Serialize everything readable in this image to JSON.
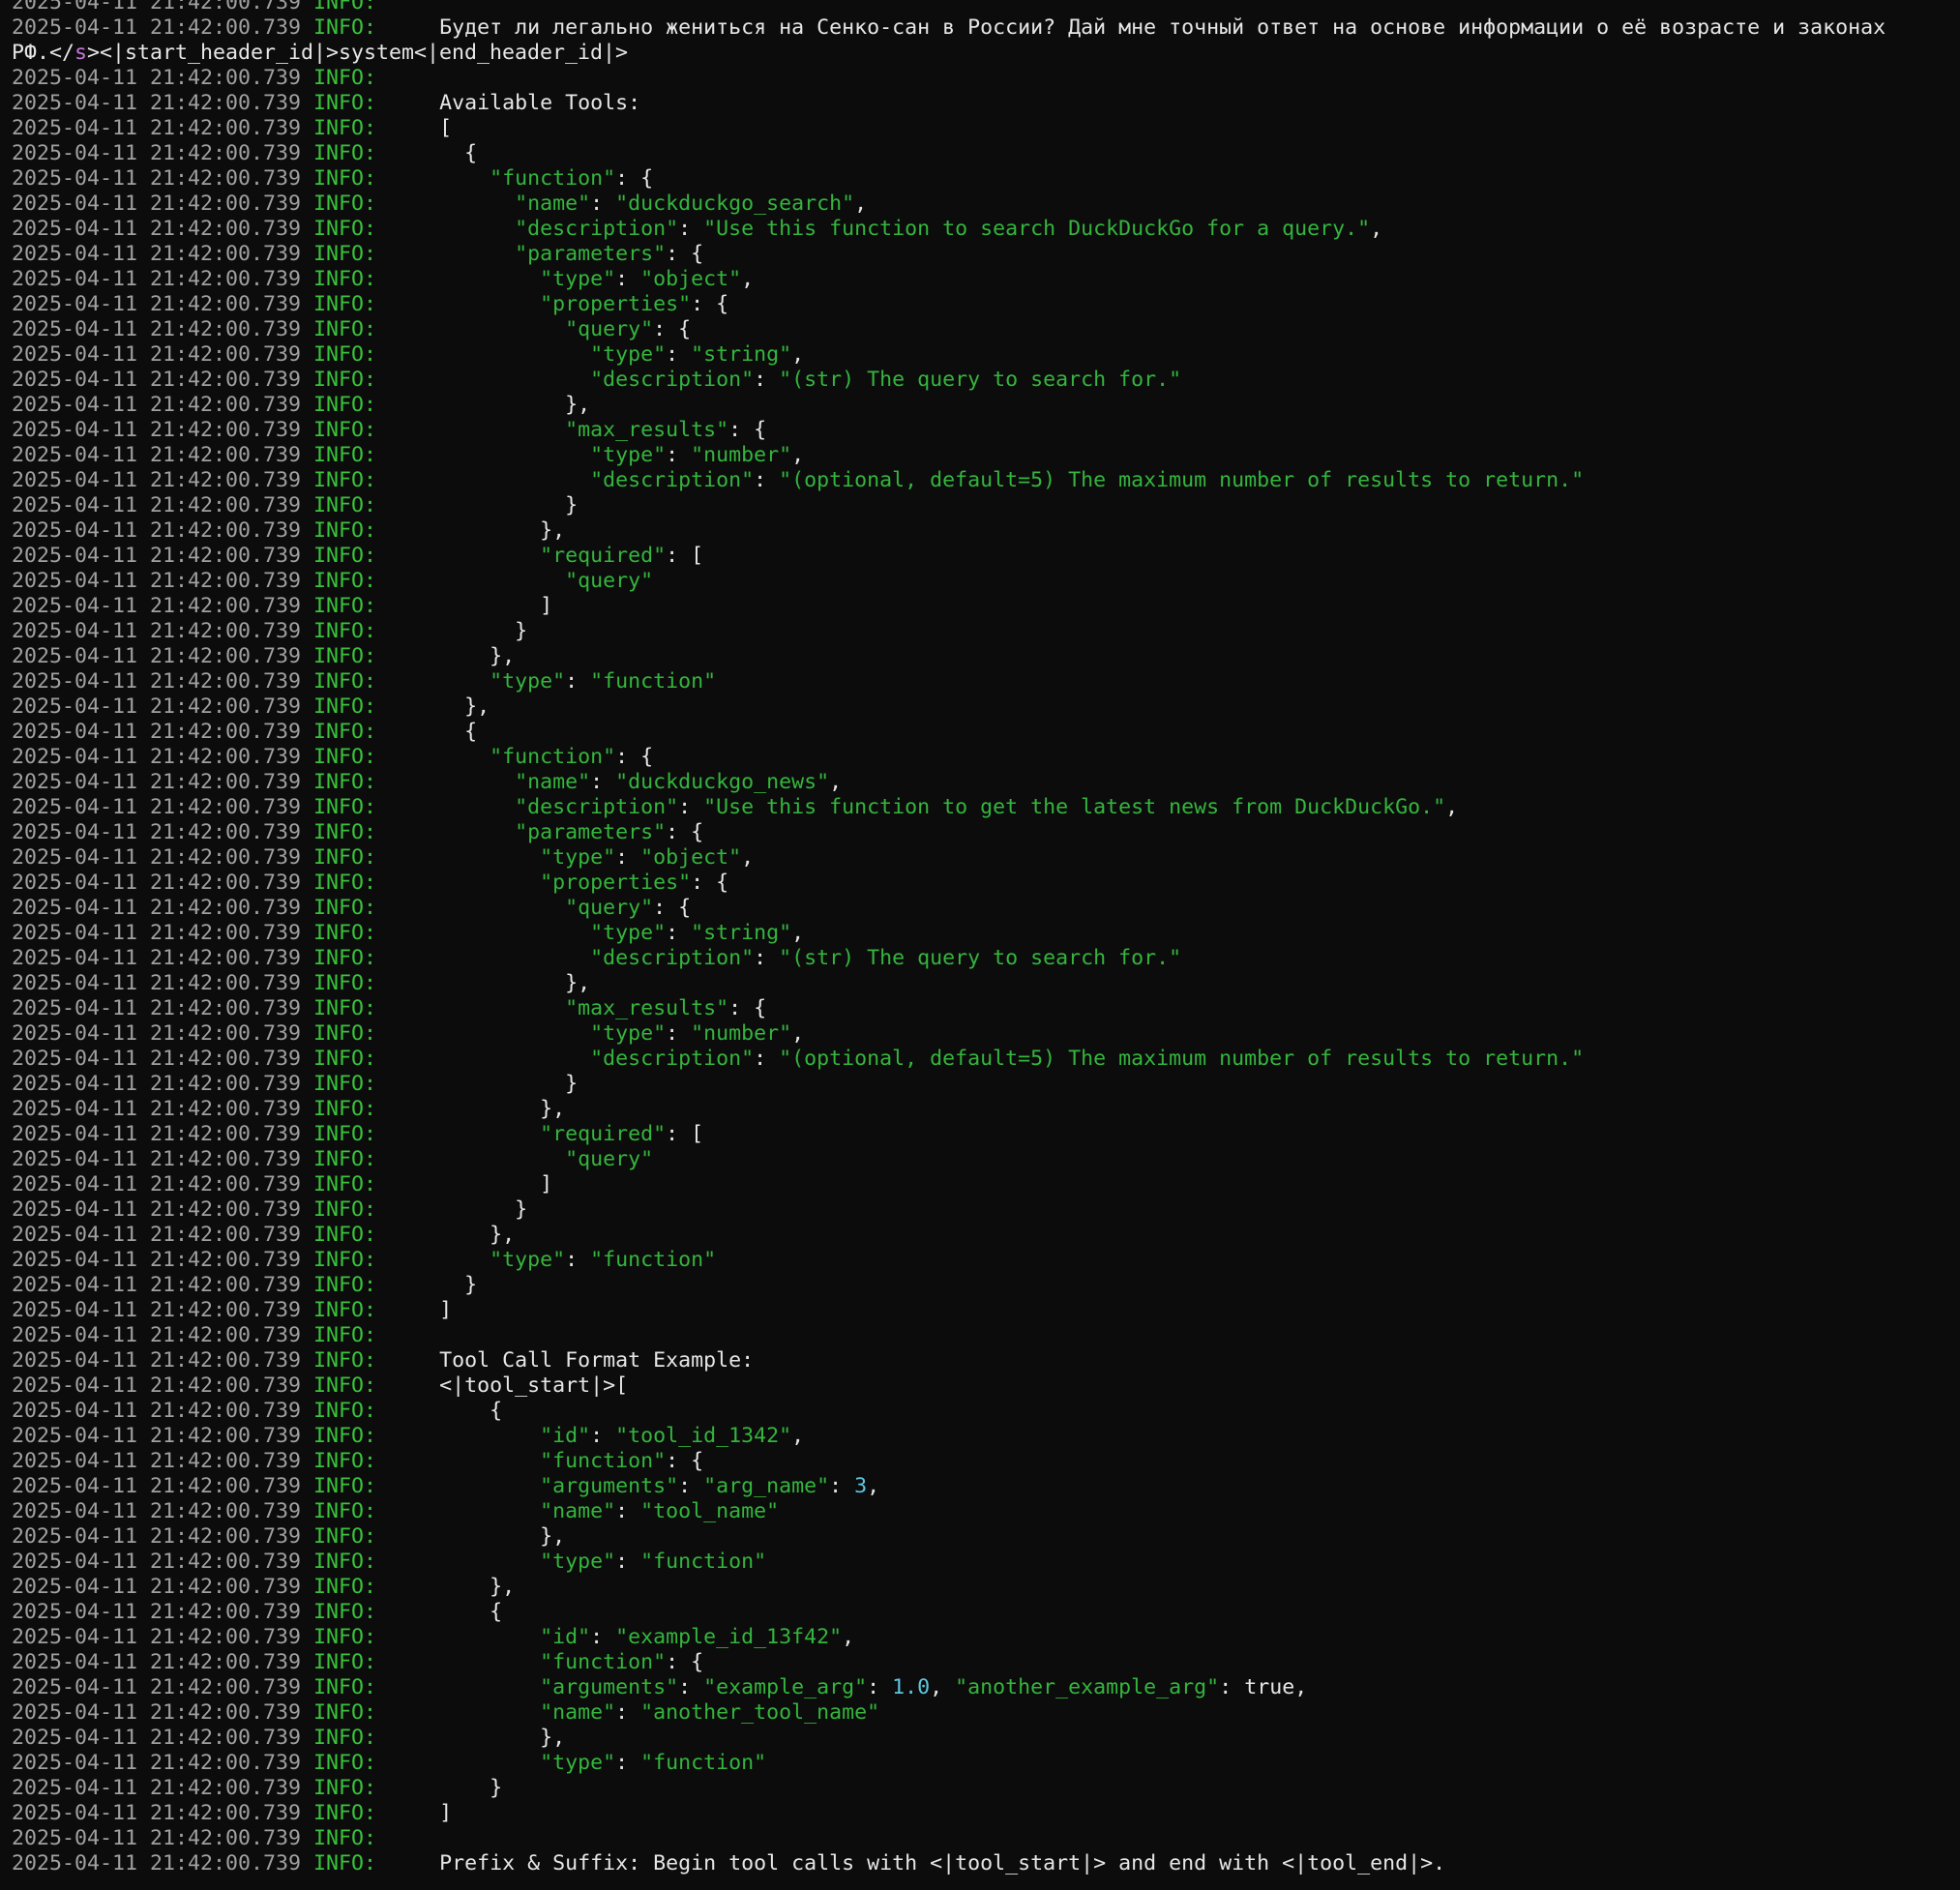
{
  "terminal": {
    "timestamp": "2025-04-11 21:42:00.739",
    "level": "INFO:",
    "lines": [
      {
        "type": "log",
        "text": ""
      },
      {
        "type": "log",
        "text": "Будет ли легально жениться на Сенко-сан в России? Дай мне точный ответ на основе информации о её возрасте и законах"
      },
      {
        "type": "raw",
        "text": "РФ.</s><|start_header_id|>system<|end_header_id|>"
      },
      {
        "type": "log",
        "text": ""
      },
      {
        "type": "log",
        "text": "Available Tools:"
      },
      {
        "type": "log",
        "text": "["
      },
      {
        "type": "log",
        "text": "  {"
      },
      {
        "type": "log",
        "text": "    \"function\": {"
      },
      {
        "type": "log",
        "text": "      \"name\": \"duckduckgo_search\","
      },
      {
        "type": "log",
        "text": "      \"description\": \"Use this function to search DuckDuckGo for a query.\","
      },
      {
        "type": "log",
        "text": "      \"parameters\": {"
      },
      {
        "type": "log",
        "text": "        \"type\": \"object\","
      },
      {
        "type": "log",
        "text": "        \"properties\": {"
      },
      {
        "type": "log",
        "text": "          \"query\": {"
      },
      {
        "type": "log",
        "text": "            \"type\": \"string\","
      },
      {
        "type": "log",
        "text": "            \"description\": \"(str) The query to search for.\""
      },
      {
        "type": "log",
        "text": "          },"
      },
      {
        "type": "log",
        "text": "          \"max_results\": {"
      },
      {
        "type": "log",
        "text": "            \"type\": \"number\","
      },
      {
        "type": "log",
        "text": "            \"description\": \"(optional, default=5) The maximum number of results to return.\""
      },
      {
        "type": "log",
        "text": "          }"
      },
      {
        "type": "log",
        "text": "        },"
      },
      {
        "type": "log",
        "text": "        \"required\": ["
      },
      {
        "type": "log",
        "text": "          \"query\""
      },
      {
        "type": "log",
        "text": "        ]"
      },
      {
        "type": "log",
        "text": "      }"
      },
      {
        "type": "log",
        "text": "    },"
      },
      {
        "type": "log",
        "text": "    \"type\": \"function\""
      },
      {
        "type": "log",
        "text": "  },"
      },
      {
        "type": "log",
        "text": "  {"
      },
      {
        "type": "log",
        "text": "    \"function\": {"
      },
      {
        "type": "log",
        "text": "      \"name\": \"duckduckgo_news\","
      },
      {
        "type": "log",
        "text": "      \"description\": \"Use this function to get the latest news from DuckDuckGo.\","
      },
      {
        "type": "log",
        "text": "      \"parameters\": {"
      },
      {
        "type": "log",
        "text": "        \"type\": \"object\","
      },
      {
        "type": "log",
        "text": "        \"properties\": {"
      },
      {
        "type": "log",
        "text": "          \"query\": {"
      },
      {
        "type": "log",
        "text": "            \"type\": \"string\","
      },
      {
        "type": "log",
        "text": "            \"description\": \"(str) The query to search for.\""
      },
      {
        "type": "log",
        "text": "          },"
      },
      {
        "type": "log",
        "text": "          \"max_results\": {"
      },
      {
        "type": "log",
        "text": "            \"type\": \"number\","
      },
      {
        "type": "log",
        "text": "            \"description\": \"(optional, default=5) The maximum number of results to return.\""
      },
      {
        "type": "log",
        "text": "          }"
      },
      {
        "type": "log",
        "text": "        },"
      },
      {
        "type": "log",
        "text": "        \"required\": ["
      },
      {
        "type": "log",
        "text": "          \"query\""
      },
      {
        "type": "log",
        "text": "        ]"
      },
      {
        "type": "log",
        "text": "      }"
      },
      {
        "type": "log",
        "text": "    },"
      },
      {
        "type": "log",
        "text": "    \"type\": \"function\""
      },
      {
        "type": "log",
        "text": "  }"
      },
      {
        "type": "log",
        "text": "]"
      },
      {
        "type": "log",
        "text": ""
      },
      {
        "type": "log",
        "text": "Tool Call Format Example:"
      },
      {
        "type": "log",
        "text": "<|tool_start|>["
      },
      {
        "type": "log",
        "text": "    {"
      },
      {
        "type": "log",
        "text": "        \"id\": \"tool_id_1342\","
      },
      {
        "type": "log",
        "text": "        \"function\": {"
      },
      {
        "type": "log",
        "text": "        \"arguments\": \"arg_name\": 3,"
      },
      {
        "type": "log",
        "text": "        \"name\": \"tool_name\""
      },
      {
        "type": "log",
        "text": "        },"
      },
      {
        "type": "log",
        "text": "        \"type\": \"function\""
      },
      {
        "type": "log",
        "text": "    },"
      },
      {
        "type": "log",
        "text": "    {"
      },
      {
        "type": "log",
        "text": "        \"id\": \"example_id_13f42\","
      },
      {
        "type": "log",
        "text": "        \"function\": {"
      },
      {
        "type": "log",
        "text": "        \"arguments\": \"example_arg\": 1.0, \"another_example_arg\": true,"
      },
      {
        "type": "log",
        "text": "        \"name\": \"another_tool_name\""
      },
      {
        "type": "log",
        "text": "        },"
      },
      {
        "type": "log",
        "text": "        \"type\": \"function\""
      },
      {
        "type": "log",
        "text": "    }"
      },
      {
        "type": "log",
        "text": "]"
      },
      {
        "type": "log",
        "text": ""
      },
      {
        "type": "log",
        "text": "Prefix & Suffix: Begin tool calls with <|tool_start|> and end with <|tool_end|>."
      }
    ]
  },
  "colors": {
    "background": "#0c0c0c",
    "timestamp": "#a0a0a0",
    "level": "#39c33b",
    "text": "#e6e6e6",
    "json_string": "#34b53d",
    "json_number": "#5fc6e0",
    "special_tag": "#c678dd"
  }
}
